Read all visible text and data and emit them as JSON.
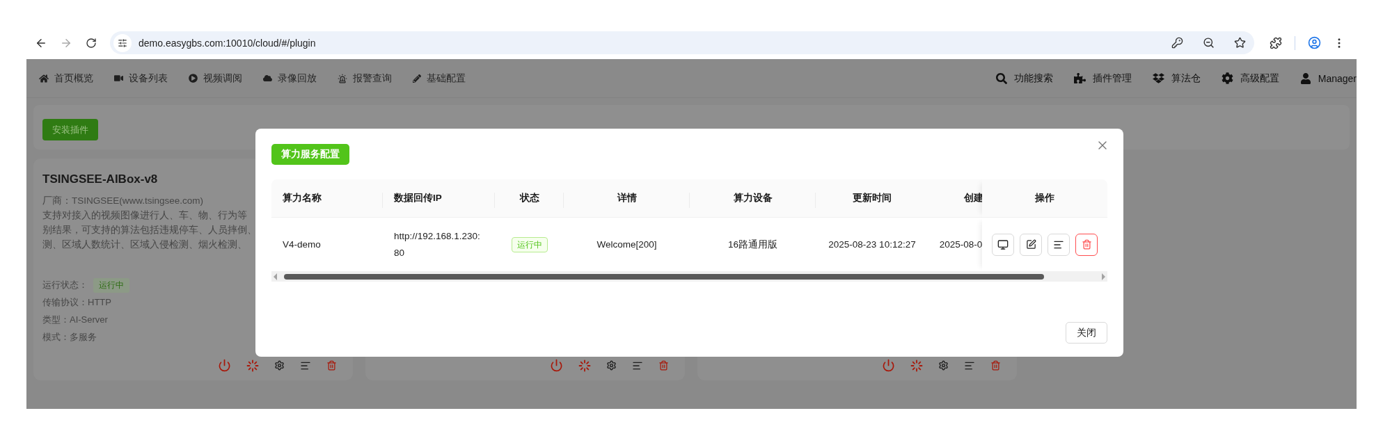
{
  "browser": {
    "url": "demo.easygbs.com:10010/cloud/#/plugin"
  },
  "nav": {
    "left": [
      "首页概览",
      "设备列表",
      "视频调阅",
      "录像回放",
      "报警查询",
      "基础配置"
    ],
    "right": [
      "功能搜索",
      "插件管理",
      "算法仓",
      "高级配置",
      "Manager"
    ]
  },
  "install_button": "安装插件",
  "plugins": [
    {
      "kind": "full",
      "title": "TSINGSEE-AIBox-v8",
      "vendor": "厂商：TSINGSEE(www.tsingsee.com)",
      "description": [
        "支持对接入的视频图像进行人、车、物、行为等",
        "别结果，可支持的算法包括违规停车、人员摔倒、",
        "测、区域人数统计、区域入侵检测、烟火检测、"
      ],
      "fields": [
        {
          "kind": "badge",
          "label": "运行状态：",
          "value": "运行中"
        },
        {
          "kind": "text",
          "label": "传输协议：",
          "value": "HTTP"
        },
        {
          "kind": "text",
          "label": "类型：",
          "value": "AI-Server"
        },
        {
          "kind": "text",
          "label": "模式：",
          "value": "多服务"
        }
      ]
    },
    {
      "kind": "covered"
    },
    {
      "kind": "covered"
    }
  ],
  "modal": {
    "config_button": "算力服务配置",
    "columns": [
      "算力名称",
      "数据回传IP",
      "状态",
      "详情",
      "算力设备",
      "更新时间",
      "创建",
      "操作"
    ],
    "rows": [
      {
        "name": "V4-demo",
        "ip": "http://192.168.1.230:80",
        "status": "运行中",
        "detail": "Welcome[200]",
        "device": "16路通用版",
        "updated": "2025-08-23 10:12:27",
        "created": "2025-08-0"
      }
    ],
    "close_button": "关闭"
  }
}
